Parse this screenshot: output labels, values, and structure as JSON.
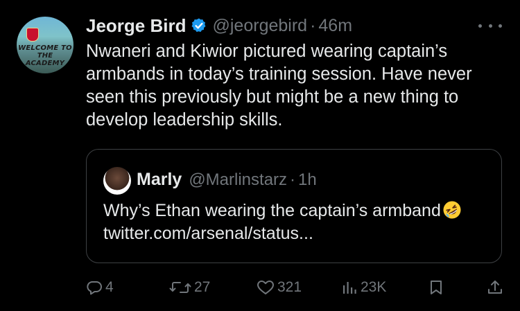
{
  "tweet": {
    "author_name": "Jeorge Bird",
    "handle": "@jeorgebird",
    "separator": "·",
    "time": "46m",
    "text": "Nwaneri and Kiwior pictured wearing captain’s armbands in today’s training session. Have never seen this previously but might be a new thing to develop leadership skills.",
    "avatar_sign_line1": "WELCOME TO",
    "avatar_sign_line2": "THE ACADEMY"
  },
  "quoted": {
    "author_name": "Marly",
    "handle": "@Marlinstarz",
    "separator": "·",
    "time": "1h",
    "text_before_emoji": "Why’s Ethan wearing the captain’s armband",
    "emoji": "rolling-on-floor-laughing",
    "link": "twitter.com/arsenal/status..."
  },
  "actions": {
    "replies": "4",
    "retweets": "27",
    "likes": "321",
    "views": "23K"
  },
  "colors": {
    "background": "#000000",
    "text_primary": "#e7e9ea",
    "text_secondary": "#71767b",
    "verified_blue": "#1d9bf0",
    "border": "#3e4144"
  },
  "icons": [
    "verified-badge-icon",
    "more-icon",
    "reply-icon",
    "retweet-icon",
    "like-icon",
    "views-icon",
    "bookmark-icon",
    "share-icon"
  ]
}
